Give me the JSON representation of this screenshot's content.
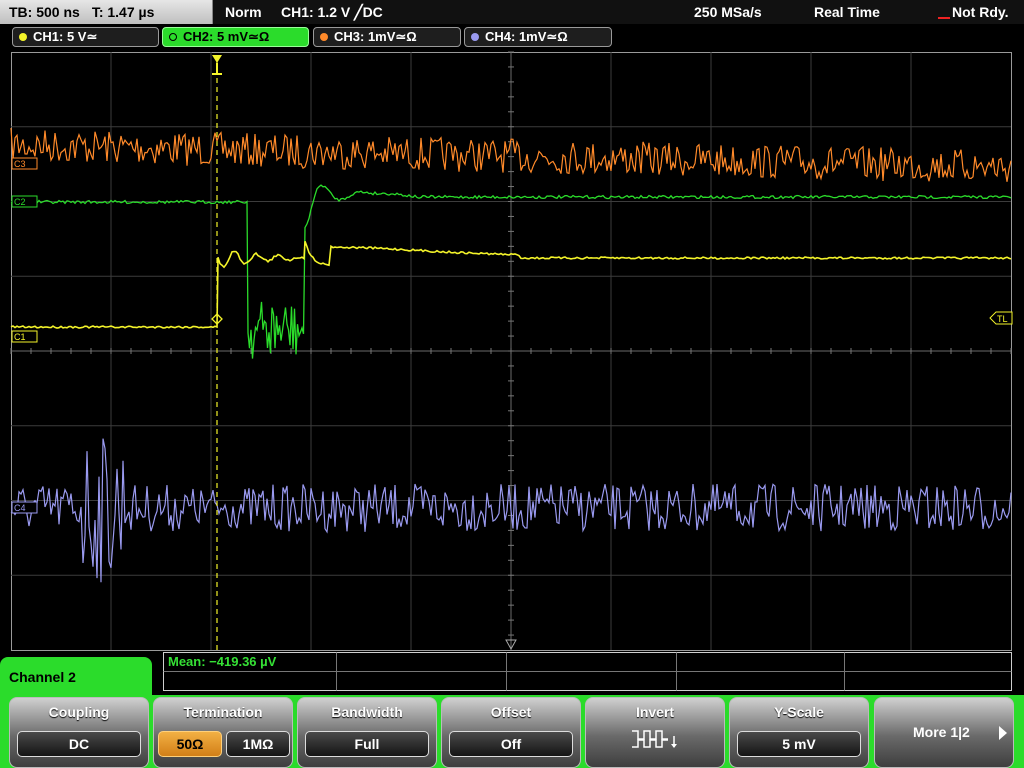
{
  "status": {
    "timebase": "TB: 500 ns",
    "trigger_time": "T: 1.47 µs",
    "mode": "Norm",
    "trigger": "CH1: 1.2 V ╱DC",
    "sample_rate": "250 MSa/s",
    "acq_mode": "Real Time",
    "state": "Not Rdy."
  },
  "channels": [
    {
      "label": "CH1: 5 V≃",
      "color": "#f4f42a"
    },
    {
      "label": "CH2: 5 mV≃Ω",
      "color": "#2bdc2b"
    },
    {
      "label": "CH3: 1mV≃Ω",
      "color": "#ff8a2a"
    },
    {
      "label": "CH4: 1mV≃Ω",
      "color": "#9a9af0"
    }
  ],
  "markers": {
    "c1": "C1",
    "c2": "C2",
    "c3": "C3",
    "c4": "C4",
    "tl": "TL"
  },
  "measurement": {
    "label": "Mean: −419.36 µV"
  },
  "panel": {
    "title": "Channel 2"
  },
  "softkeys": {
    "coupling": {
      "title": "Coupling",
      "value": "DC"
    },
    "termination": {
      "title": "Termination",
      "opt1": "50Ω",
      "opt2": "1MΩ",
      "selected": "50Ω"
    },
    "bandwidth": {
      "title": "Bandwidth",
      "value": "Full"
    },
    "offset": {
      "title": "Offset",
      "value": "Off"
    },
    "invert": {
      "title": "Invert",
      "icon": "invert-waveform-icon"
    },
    "yscale": {
      "title": "Y-Scale",
      "value": "5 mV"
    },
    "more": {
      "label": "More 1|2",
      "icon": "arrow-right-icon"
    }
  },
  "colors": {
    "ch1": "#f4f42a",
    "ch2": "#2bdc2b",
    "ch3": "#ff8a2a",
    "ch4": "#9a9af0",
    "grid": "#4a4a4a"
  }
}
